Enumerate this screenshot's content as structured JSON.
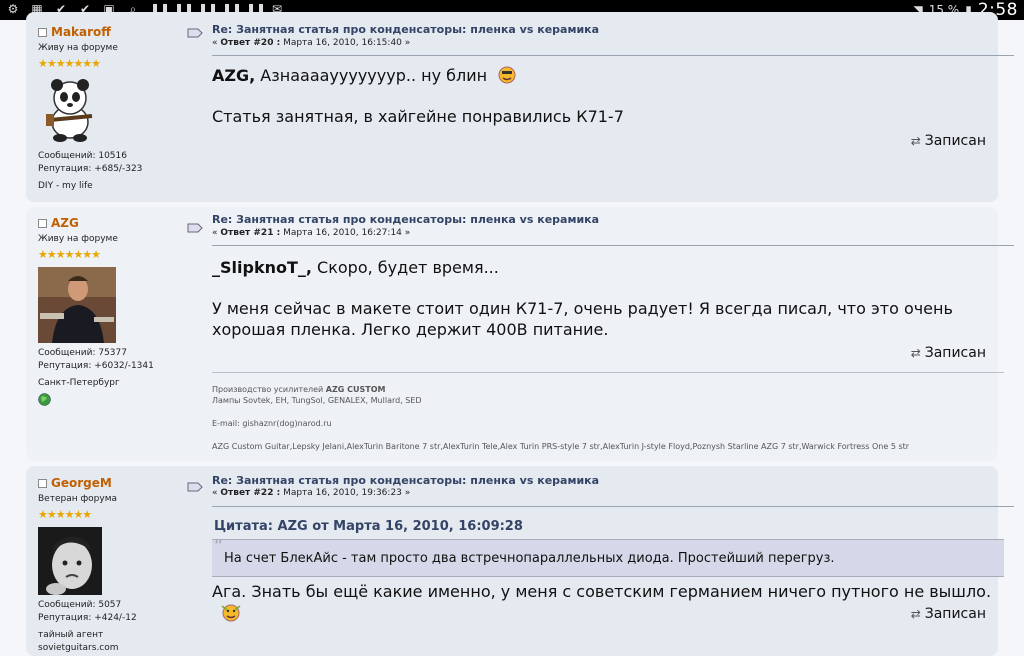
{
  "statusbar": {
    "icons": [
      "settings-icon",
      "image-icon",
      "check-icon",
      "check-icon",
      "gallery-icon",
      "search-icon",
      "pause-icon",
      "pause-icon",
      "pause-icon",
      "pause-icon",
      "pause-icon",
      "mail-icon"
    ],
    "battery": "15 %",
    "time": "2:58"
  },
  "posts": [
    {
      "author": "Makaroff",
      "role": "Живу на форуме",
      "stars": "★★★★★★★",
      "messages": "Сообщений: 10516",
      "reputation": "Репутация: +685/-323",
      "extra": "DIY - my life",
      "subject": "Re: Занятная статья про конденсаторы: пленка vs керамика",
      "meta_prefix": "« ",
      "meta_reply": "Ответ #20 :",
      "meta_date": " Марта 16, 2010, 16:15:40 »",
      "addressee": "AZG,",
      "line1": " Азнааааууууууур.. ну блин",
      "line2": "Статья занятная, в хайгейне понравились К71-7",
      "saved": "Записан"
    },
    {
      "author": "AZG",
      "role": "Живу на форуме",
      "stars": "★★★★★★★",
      "messages": "Сообщений: 75377",
      "reputation": "Репутация: +6032/-1341",
      "city": "Санкт-Петербург",
      "subject": "Re: Занятная статья про конденсаторы: пленка vs керамика",
      "meta_prefix": "« ",
      "meta_reply": "Ответ #21 :",
      "meta_date": " Марта 16, 2010, 16:27:14 »",
      "addressee": "_SlipknoT_,",
      "line1": " Скоро, будет время...",
      "line2": "У меня сейчас в макете стоит один К71-7, очень радует! Я всегда писал, что это очень хорошая пленка. Легко держит 400В питание.",
      "saved": "Записан",
      "sig1_prefix": "Производство усилителей ",
      "sig1_bold": "AZG CUSTOM",
      "sig2": "Лампы Sovtek, EH, TungSol, GENALEX, Mullard, SED",
      "sig3": "E-mail: gishaznr(dog)narod.ru",
      "sig4": "AZG Custom Guitar,Lepsky Jelani,AlexTurin Baritone 7 str,AlexTurin Tele,Alex Turin PRS-style 7 str,AlexTurin J-style Floyd,Poznysh Starline AZG 7 str,Warwick Fortress One 5 str"
    },
    {
      "author": "GeorgeM",
      "role": "Ветеран форума",
      "stars": "★★★★★★",
      "messages": "Сообщений: 5057",
      "reputation": "Репутация: +424/-12",
      "extra": "тайный агент sovietguitars.com",
      "subject": "Re: Занятная статья про конденсаторы: пленка vs керамика",
      "meta_prefix": "« ",
      "meta_reply": "Ответ #22 :",
      "meta_date": " Марта 16, 2010, 19:36:23 »",
      "quote_head": "Цитата: AZG от Марта 16, 2010, 16:09:28",
      "quote_text": "На счет БлекАйс - там просто два встречнопараллельных диода. Простейший перегруз.",
      "line1": "Ага. Знать бы ещё какие именно, у меня с советским германием ничего путного не вышло.",
      "saved": "Записан"
    }
  ]
}
